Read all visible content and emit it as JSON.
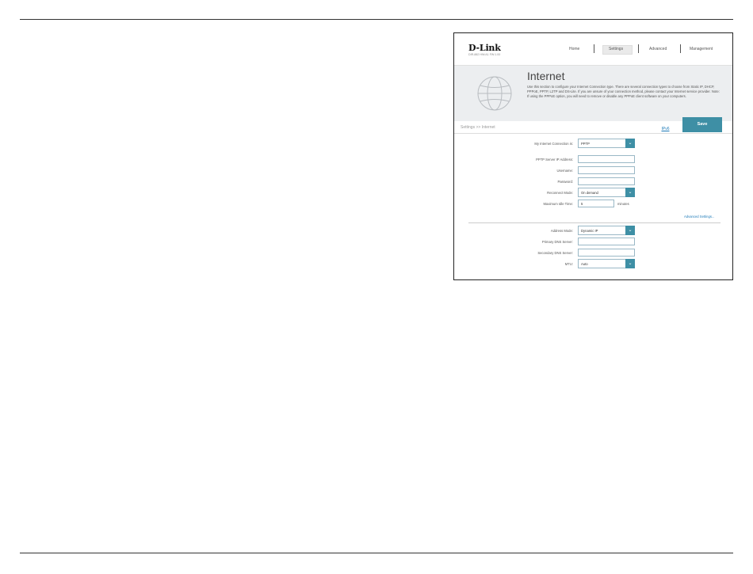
{
  "brand": {
    "logo_text": "D-Link",
    "model_info": "DIR-882   HW:A1   FW:1.00"
  },
  "nav": {
    "items": [
      "Home",
      "Settings",
      "Advanced",
      "Management"
    ],
    "active": "Settings"
  },
  "header": {
    "title": "Internet",
    "description": "Use this section to configure your Internet Connection type. There are several connection types to choose from Static IP, DHCP, PPPoE, PPTP, L2TP and DS-Lite. If you are unsure of your connection method, please contact your Internet service provider. Note: If using the PPPoE option, you will need to remove or disable any PPPoE client software on your computers.",
    "icon": "globe-icon"
  },
  "toolbar": {
    "breadcrumb": "Settings >> Internet",
    "ipv6_label": "IPv6",
    "save_label": "Save"
  },
  "form": {
    "connection_label": "My Internet Connection is:",
    "connection_value": "PPTP",
    "server_label": "PPTP Server IP Address:",
    "server_value": "",
    "username_label": "Username:",
    "username_value": "",
    "password_label": "Password:",
    "password_value": "",
    "reconnect_label": "Reconnect Mode:",
    "reconnect_value": "On demand",
    "idle_label": "Maximum Idle Time:",
    "idle_value": "5",
    "idle_unit": "minutes",
    "advanced_link": "Advanced Settings...",
    "address_mode_label": "Address Mode:",
    "address_mode_value": "Dynamic IP",
    "primary_dns_label": "Primary DNS Server:",
    "primary_dns_value": "",
    "secondary_dns_label": "Secondary DNS Server:",
    "secondary_dns_value": "",
    "mtu_label": "MTU:",
    "mtu_value": "Auto"
  },
  "colors": {
    "accent": "#3e8fa5",
    "link": "#1d7ab8",
    "header_bg": "#eceef0"
  }
}
